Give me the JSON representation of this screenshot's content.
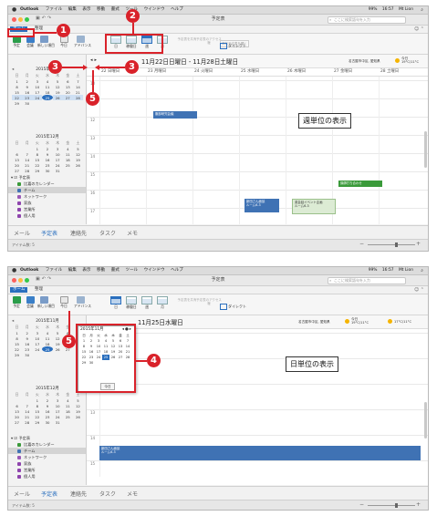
{
  "menubar": {
    "app": "Outlook",
    "menus": [
      "ファイル",
      "編集",
      "表示",
      "移動",
      "書式",
      "ツール",
      "ウインドウ",
      "ヘルプ"
    ],
    "battery": "99%",
    "time": "16:57",
    "user": "Mt Lion"
  },
  "window": {
    "title": "予定表",
    "search_placeholder": "ここに検索語句を入力"
  },
  "tabs": [
    "ホーム",
    "整理"
  ],
  "ribbon": {
    "buttons": [
      "予定",
      "会議",
      "新しい項目",
      "今日",
      "アドバンス"
    ],
    "views": [
      "日",
      "稼働日",
      "週",
      "月"
    ],
    "share_label": "予定表を共有",
    "perm_label": "予定表のアクセス権",
    "open_shared": "共有予定表を開く",
    "category": "ダイレクト"
  },
  "cal1": {
    "range": "11月22日日曜日 - 11月28日土曜日",
    "location": "名古屋市中区, 愛知県",
    "wx_label": "今日",
    "wx_temp": "19°C/11°C",
    "days": [
      "22 日曜日",
      "23 月曜日",
      "24 火曜日",
      "25 水曜日",
      "26 木曜日",
      "27 金曜日",
      "28 土曜日"
    ],
    "hours": [
      "10",
      "11",
      "12",
      "13",
      "14",
      "15",
      "16",
      "17"
    ],
    "events": [
      {
        "title": "服部研究会議"
      },
      {
        "title": "講師打ち合わせ"
      },
      {
        "title": "新田さん面談",
        "sub": "ルーム6-3"
      },
      {
        "title": "英会話イベント企画",
        "sub": "ルーム6-3"
      }
    ],
    "label": "週単位の表示"
  },
  "cal2": {
    "range": "11月25日水曜日",
    "location": "名古屋市中区, 愛知県",
    "wx1_label": "今日",
    "wx1_temp": "19°C/11°C",
    "wx2_temp": "17°C/11°C",
    "hours": [
      "10",
      "11",
      "12",
      "13",
      "14",
      "15"
    ],
    "event": {
      "title": "新田さん面談",
      "sub": "ルーム6-3"
    },
    "label": "日単位の表示"
  },
  "minical1": {
    "month": "2015年11月",
    "dow": [
      "日",
      "月",
      "火",
      "水",
      "木",
      "金",
      "土"
    ],
    "weeks": [
      [
        "1",
        "2",
        "3",
        "4",
        "5",
        "6",
        "7"
      ],
      [
        "8",
        "9",
        "10",
        "11",
        "12",
        "13",
        "14"
      ],
      [
        "15",
        "16",
        "17",
        "18",
        "19",
        "20",
        "21"
      ],
      [
        "22",
        "23",
        "24",
        "25",
        "26",
        "27",
        "28"
      ],
      [
        "29",
        "30",
        "",
        "",
        "",
        "",
        ""
      ]
    ]
  },
  "minical2": {
    "month": "2015年12月",
    "weeks": [
      [
        "",
        "",
        "1",
        "2",
        "3",
        "4",
        "5"
      ],
      [
        "6",
        "7",
        "8",
        "9",
        "10",
        "11",
        "12"
      ],
      [
        "13",
        "14",
        "15",
        "16",
        "17",
        "18",
        "19"
      ],
      [
        "20",
        "21",
        "22",
        "23",
        "24",
        "25",
        "26"
      ],
      [
        "27",
        "28",
        "29",
        "30",
        "31",
        "",
        ""
      ]
    ]
  },
  "popup": {
    "month": "2015年11月",
    "weeks": [
      [
        "1",
        "2",
        "3",
        "4",
        "5",
        "6",
        "7"
      ],
      [
        "8",
        "9",
        "10",
        "11",
        "12",
        "13",
        "14"
      ],
      [
        "15",
        "16",
        "17",
        "18",
        "19",
        "20",
        "21"
      ],
      [
        "22",
        "23",
        "24",
        "25",
        "26",
        "27",
        "28"
      ],
      [
        "29",
        "30",
        "",
        "",
        "",
        "",
        ""
      ]
    ],
    "today_btn": "今日"
  },
  "folders": {
    "root": "予定表",
    "items": [
      {
        "name": "比嘉のカレンダー",
        "color": "#3a9a3a"
      },
      {
        "name": "チーム",
        "color": "#3f72b4"
      },
      {
        "name": "ネットワーク",
        "color": "#9b59b6"
      },
      {
        "name": "家族",
        "color": "#8e44ad"
      },
      {
        "name": "営業所",
        "color": "#8e44ad"
      },
      {
        "name": "個人用",
        "color": "#8e44ad"
      }
    ]
  },
  "bottomnav": [
    "メール",
    "予定表",
    "連絡先",
    "タスク",
    "メモ"
  ],
  "status": {
    "count": "アイテム数: 5"
  },
  "callouts": [
    "1",
    "2",
    "3",
    "3",
    "4",
    "5",
    "5"
  ],
  "colors": {
    "accent": "#2a6fbe",
    "callout": "#d9222a"
  }
}
